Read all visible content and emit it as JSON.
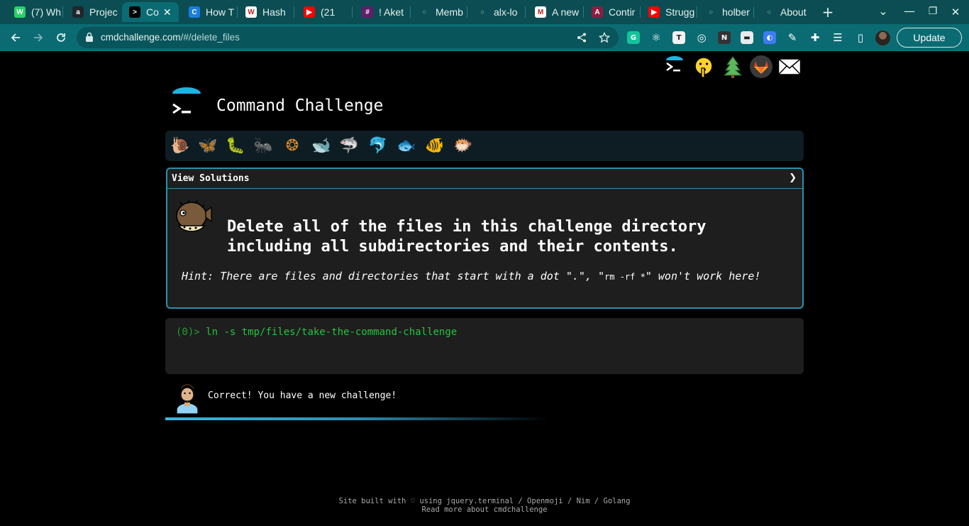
{
  "browser": {
    "tabs": [
      {
        "title": "(7) Wh",
        "icon": "whatsapp-icon",
        "color": "#25d366",
        "glyph": "W"
      },
      {
        "title": "Projec",
        "icon": "alx-icon",
        "color": "#20262b",
        "glyph": "a"
      },
      {
        "title": "Co",
        "icon": "terminal-icon",
        "color": "#000000",
        "glyph": ">",
        "active": true
      },
      {
        "title": "How T",
        "icon": "crowdbotics-icon",
        "color": "#1a7de0",
        "glyph": "C"
      },
      {
        "title": "Hash",
        "icon": "wikipedia-icon",
        "color": "#ffffff",
        "glyph": "W"
      },
      {
        "title": "(21",
        "icon": "youtube-icon",
        "color": "#ff0000",
        "glyph": "▶"
      },
      {
        "title": "! Aket",
        "icon": "slack-icon",
        "color": "#611f69",
        "glyph": "#"
      },
      {
        "title": "Memb",
        "icon": "github-icon",
        "color": "#0b4d52",
        "glyph": "○"
      },
      {
        "title": "alx-lo",
        "icon": "github-icon",
        "color": "#0b4d52",
        "glyph": "○"
      },
      {
        "title": "A new",
        "icon": "gmail-icon",
        "color": "#ffffff",
        "glyph": "M"
      },
      {
        "title": "Contir",
        "icon": "asu-icon",
        "color": "#8c1d40",
        "glyph": "A"
      },
      {
        "title": "Strugg",
        "icon": "youtube-icon",
        "color": "#ff0000",
        "glyph": "▶"
      },
      {
        "title": "holber",
        "icon": "github-icon",
        "color": "#0b4d52",
        "glyph": "○"
      },
      {
        "title": "About",
        "icon": "github-icon",
        "color": "#0b4d52",
        "glyph": "○"
      }
    ],
    "new_tab": "+",
    "tab_menu": "⌄",
    "win_minimize": "—",
    "win_restore": "❐",
    "win_close": "✕",
    "url_host": "cmdchallenge.com",
    "url_path": "/#/delete_files",
    "update_label": "Update",
    "extensions": [
      {
        "name": "grammarly-extension-icon",
        "color": "#15c39a",
        "glyph": "G"
      },
      {
        "name": "react-devtools-icon",
        "color": "#0b6b72",
        "glyph": "⚛"
      },
      {
        "name": "text-extension-icon",
        "color": "#f2f2f2",
        "glyph": "T"
      },
      {
        "name": "target-extension-icon",
        "color": "#0b6b72",
        "glyph": "◎"
      },
      {
        "name": "new-badge-extension-icon",
        "color": "#333333",
        "glyph": "N"
      },
      {
        "name": "window-extension-icon",
        "color": "#e8eaed",
        "glyph": "▬"
      },
      {
        "name": "sync-extension-icon",
        "color": "#3d7bf4",
        "glyph": "◐"
      },
      {
        "name": "color-picker-extension-icon",
        "color": "#0b6b72",
        "glyph": "✎"
      },
      {
        "name": "extensions-puzzle-icon",
        "color": "#0b6b72",
        "glyph": "✚"
      },
      {
        "name": "media-controls-icon",
        "color": "#0b6b72",
        "glyph": "☰"
      },
      {
        "name": "side-panel-icon",
        "color": "#0b6b72",
        "glyph": "▯"
      }
    ]
  },
  "site": {
    "title": "Command Challenge",
    "levels": [
      {
        "name": "level-snail-icon",
        "glyph": "🐌"
      },
      {
        "name": "level-butterfly-icon",
        "glyph": "🦋"
      },
      {
        "name": "level-caterpillar-icon",
        "glyph": "🐛"
      },
      {
        "name": "level-ant-icon",
        "glyph": "🐜"
      },
      {
        "name": "level-microbe-icon",
        "glyph": "❂"
      },
      {
        "name": "level-whale-icon",
        "glyph": "🐋"
      },
      {
        "name": "level-shark-icon",
        "glyph": "🦈"
      },
      {
        "name": "level-dolphin-icon",
        "glyph": "🐬"
      },
      {
        "name": "level-fish-icon",
        "glyph": "🐟"
      },
      {
        "name": "level-tropical-fish-icon",
        "glyph": "🐠"
      },
      {
        "name": "level-blowfish-icon",
        "glyph": "🐡"
      }
    ],
    "view_solutions": "View Solutions",
    "expand_arrow": "❯",
    "challenge_text": "Delete all of the files in this challenge directory including all subdirectories and their contents.",
    "hint_prefix": "Hint: There are files and directories that start with a dot \".\", \"",
    "hint_code": "rm -rf *",
    "hint_suffix": "\" won't work here!",
    "terminal_prompt": "(0)> ",
    "terminal_command": "ln -s tmp/files/take-the-command-challenge",
    "feedback": "Correct! You have a new challenge!",
    "footer_line1": "Site built with ♡ using jquery.terminal / Openmoji / Nim / Golang",
    "footer_line2": "Read more about cmdchallenge"
  }
}
